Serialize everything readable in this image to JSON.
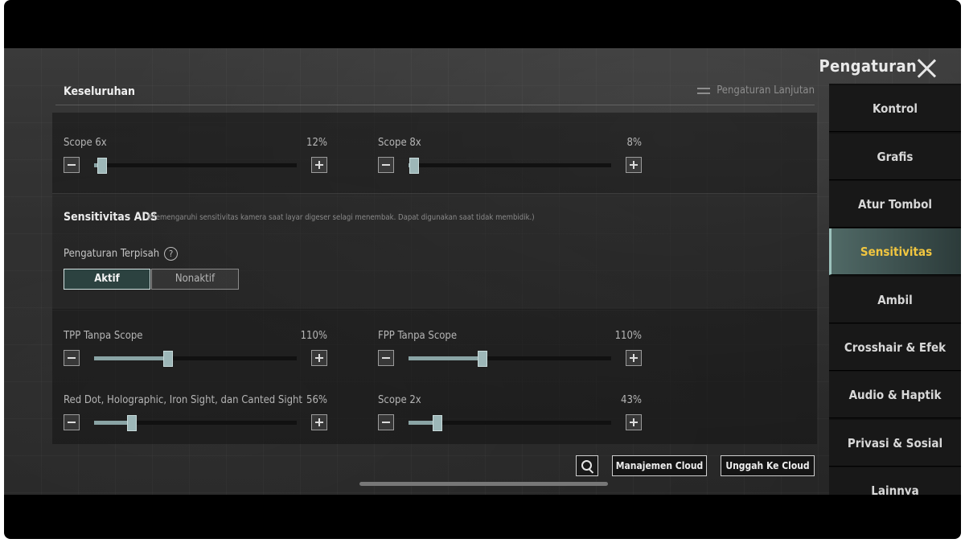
{
  "header": {
    "title": "Pengaturan"
  },
  "section": {
    "title": "Keseluruhan",
    "advanced_label": "Pengaturan Lanjutan"
  },
  "scope_sliders": [
    {
      "label": "Scope 6x",
      "value": "12%",
      "level": 12
    },
    {
      "label": "Scope 8x",
      "value": "8%",
      "level": 8
    }
  ],
  "ads": {
    "title": "Sensitivitas ADS",
    "description": "(Memengaruhi sensitivitas kamera saat layar digeser selagi menembak. Dapat digunakan saat tidak membidik.)",
    "separate_label": "Pengaturan Terpisah",
    "help_icon": "?",
    "toggle_on": "Aktif",
    "toggle_off": "Nonaktif",
    "toggle_selected": "Aktif"
  },
  "ads_sliders": [
    {
      "label": "TPP Tanpa Scope",
      "value": "110%",
      "level": 110
    },
    {
      "label": "FPP Tanpa Scope",
      "value": "110%",
      "level": 110
    },
    {
      "label": "Red Dot, Holographic, Iron Sight, dan Canted Sight",
      "value": "56%",
      "level": 56
    },
    {
      "label": "Scope 2x",
      "value": "43%",
      "level": 43
    }
  ],
  "footer": {
    "cloud_manage": "Manajemen Cloud",
    "cloud_upload": "Unggah Ke Cloud"
  },
  "nav": {
    "items": [
      "Kontrol",
      "Grafis",
      "Atur Tombol",
      "Sensitivitas",
      "Ambil",
      "Crosshair & Efek",
      "Audio & Haptik",
      "Privasi & Sosial",
      "Lainnya"
    ],
    "active": "Sensitivitas"
  },
  "colors": {
    "accent": "#f1c640",
    "slider_fill": "#8aa4a5",
    "active_nav": "#506966"
  }
}
